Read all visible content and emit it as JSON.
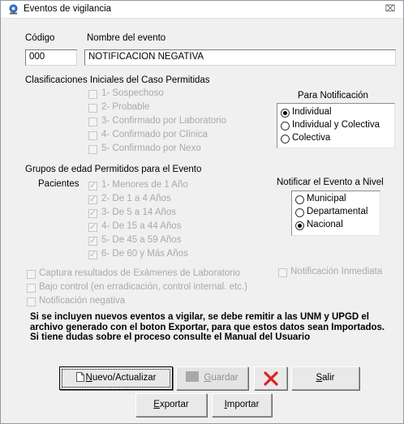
{
  "window": {
    "title": "Eventos de vigilancia",
    "close_glyph": "⌧"
  },
  "header": {
    "code_label": "Código",
    "name_label": "Nombre del evento",
    "code_value": "000",
    "name_value": "NOTIFICACION NEGATIVA"
  },
  "classifications": {
    "title": "Clasificaciones Iniciales del Caso Permitidas",
    "items": [
      "1- Sospechoso",
      "2- Probable",
      "3- Confirmado por Laboratorio",
      "4- Confirmado por Clínica",
      "5- Confirmado por Nexo"
    ]
  },
  "notification": {
    "title": "Para Notificación",
    "options": [
      "Individual",
      "Individual y Colectiva",
      "Colectiva"
    ],
    "selected": "Individual"
  },
  "age_groups": {
    "title": "Grupos de edad Permitidos para el Evento",
    "patients_label": "Pacientes",
    "items": [
      "1- Menores de 1 Año",
      "2- De 1 a 4 Años",
      "3- De 5 a 14 Años",
      "4- De 15 a 44 Años",
      "5- De 45 a 59 Años",
      "6- De 60 y Más Años"
    ]
  },
  "level": {
    "title": "Notificar el Evento a Nivel",
    "options": [
      "Municipal",
      "Departamental",
      "Nacional"
    ],
    "selected": "Nacional"
  },
  "options": {
    "lab_results": "Captura resultados de Exámenes de Laboratorio",
    "immediate": "Notificación Inmediata",
    "control": "Bajo control (en erradicación, control internal. etc.)",
    "negative": "Notificación negativa"
  },
  "note_text": "Si se incluyen nuevos eventos a vigilar, se debe remitir a las UNM y UPGD el archivo generado con el boton Exportar, para que estos datos sean Importados. Si tiene dudas sobre el proceso consulte el Manual del Usuario",
  "buttons": {
    "new_first": "N",
    "new_rest": "uevo/Actualizar",
    "save_first": "G",
    "save_rest": "uardar",
    "exit_first": "S",
    "exit_rest": "alir",
    "export_first": "E",
    "export_rest": "xportar",
    "import_first": "I",
    "import_rest": "mportar"
  },
  "colors": {
    "dialog_bg": "#f0f0f0",
    "delete_x": "#e02020",
    "disabled_text": "#a9a9a9"
  }
}
